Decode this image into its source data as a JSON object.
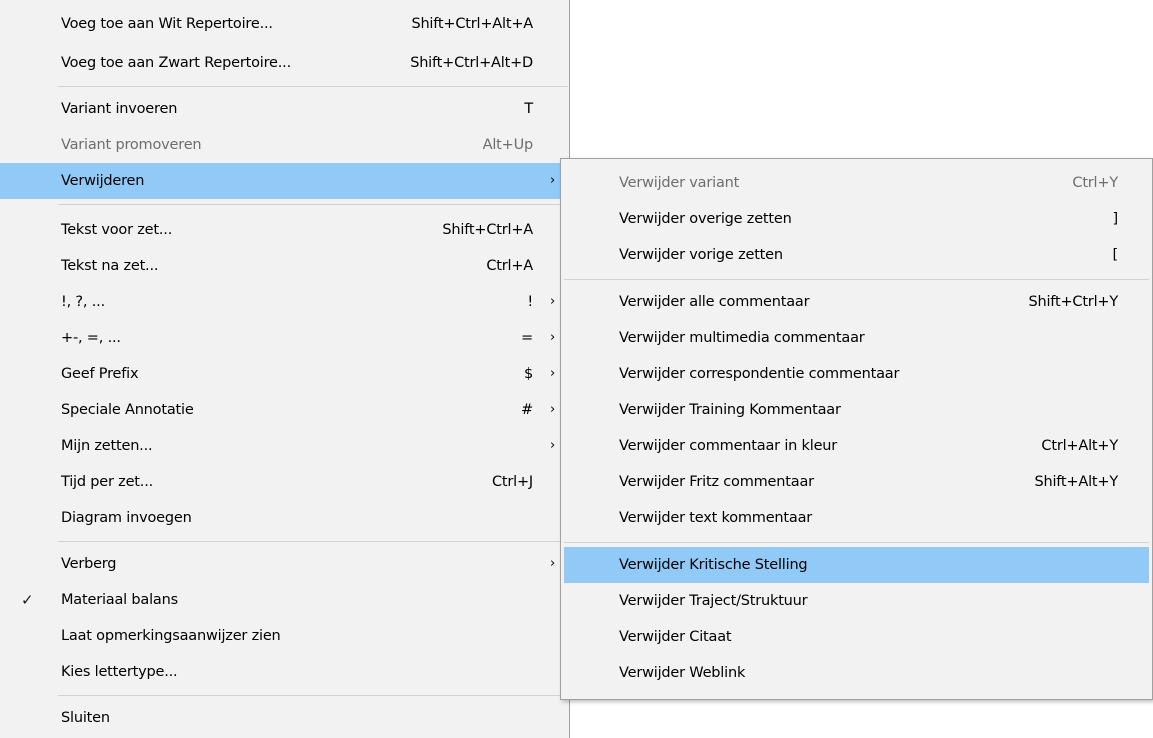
{
  "main_menu": {
    "items": [
      {
        "label": "Voeg toe aan Wit Repertoire...",
        "shortcut": "Shift+Ctrl+Alt+A"
      },
      {
        "label": "Voeg toe aan Zwart Repertoire...",
        "shortcut": "Shift+Ctrl+Alt+D"
      },
      {
        "label": "Variant invoeren",
        "shortcut": "T"
      },
      {
        "label": "Variant promoveren",
        "shortcut": "Alt+Up",
        "disabled": true
      },
      {
        "label": "Verwijderen",
        "arrow": "›",
        "highlighted": true
      },
      {
        "label": "Tekst voor zet...",
        "shortcut": "Shift+Ctrl+A"
      },
      {
        "label": "Tekst na zet...",
        "shortcut": "Ctrl+A"
      },
      {
        "label": "!, ?, ...",
        "shortcut": "!",
        "arrow": "›"
      },
      {
        "label": "+-, =, ...",
        "shortcut": "=",
        "arrow": "›"
      },
      {
        "label": "Geef Prefix",
        "shortcut": "$",
        "arrow": "›"
      },
      {
        "label": "Speciale Annotatie",
        "shortcut": "#",
        "arrow": "›"
      },
      {
        "label": "Mijn zetten...",
        "arrow": "›"
      },
      {
        "label": "Tijd per zet...",
        "shortcut": "Ctrl+J"
      },
      {
        "label": "Diagram invoegen"
      },
      {
        "label": "Verberg",
        "arrow": "›"
      },
      {
        "label": "Materiaal balans",
        "checked": true,
        "check": "✓"
      },
      {
        "label": "Laat opmerkingsaanwijzer zien"
      },
      {
        "label": "Kies lettertype..."
      },
      {
        "label": "Sluiten"
      }
    ]
  },
  "sub_menu": {
    "title_parent": "Verwijderen",
    "items": [
      {
        "label": "Verwijder variant",
        "shortcut": "Ctrl+Y",
        "disabled": true
      },
      {
        "label": "Verwijder overige zetten",
        "shortcut": "]"
      },
      {
        "label": "Verwijder vorige zetten",
        "shortcut": "["
      },
      {
        "label": "Verwijder alle commentaar",
        "shortcut": "Shift+Ctrl+Y"
      },
      {
        "label": "Verwijder multimedia commentaar"
      },
      {
        "label": "Verwijder correspondentie commentaar"
      },
      {
        "label": "Verwijder Training Kommentaar"
      },
      {
        "label": "Verwijder commentaar in kleur",
        "shortcut": "Ctrl+Alt+Y"
      },
      {
        "label": "Verwijder Fritz commentaar",
        "shortcut": "Shift+Alt+Y"
      },
      {
        "label": "Verwijder text kommentaar"
      },
      {
        "label": "Verwijder Kritische Stelling",
        "highlighted": true
      },
      {
        "label": "Verwijder Traject/Struktuur"
      },
      {
        "label": "Verwijder Citaat"
      },
      {
        "label": "Verwijder Weblink"
      }
    ]
  },
  "colors": {
    "menu_background": "#f2f2f2",
    "highlight": "#91c9f7",
    "separator": "#d2d2d2",
    "disabled_text": "#6d6d6d"
  }
}
